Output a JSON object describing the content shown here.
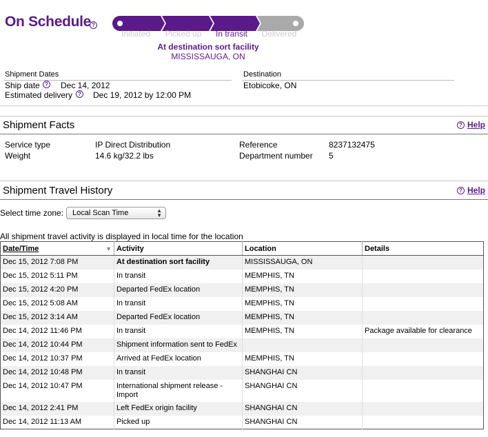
{
  "header": {
    "status_title": "On Schedule",
    "progress_steps": [
      "Initiated",
      "Picked up",
      "In transit",
      "Delivered"
    ],
    "current_step": "In transit",
    "status_line1": "At destination sort facility",
    "status_line2": "MISSISSAUGA, ON"
  },
  "dates": {
    "heading": "Shipment Dates",
    "ship_date_label": "Ship date",
    "ship_date_value": "Dec 14, 2012",
    "est_delivery_label": "Estimated delivery",
    "est_delivery_value": "Dec 19, 2012 by 12:00 PM",
    "destination_heading": "Destination",
    "destination_value": "Etobicoke, ON"
  },
  "facts": {
    "title": "Shipment Facts",
    "help": "Help",
    "service_type_label": "Service type",
    "service_type_value": "IP Direct Distribution",
    "weight_label": "Weight",
    "weight_value": "14.6 kg/32.2 lbs",
    "reference_label": "Reference",
    "reference_value": "8237132475",
    "department_label": "Department number",
    "department_value": "5"
  },
  "history": {
    "title": "Shipment Travel History",
    "help": "Help",
    "tz_label": "Select time zone:",
    "tz_value": "Local Scan Time",
    "note": "All shipment travel activity is displayed in local time for the location",
    "columns": [
      "Date/Time",
      "Activity",
      "Location",
      "Details"
    ],
    "rows": [
      {
        "datetime": "Dec 15, 2012 7:08 PM",
        "activity": "At destination sort facility",
        "location": "MISSISSAUGA, ON",
        "details": ""
      },
      {
        "datetime": "Dec 15, 2012 5:11 PM",
        "activity": "In transit",
        "location": "MEMPHIS, TN",
        "details": ""
      },
      {
        "datetime": "Dec 15, 2012 4:20 PM",
        "activity": "Departed FedEx location",
        "location": "MEMPHIS, TN",
        "details": ""
      },
      {
        "datetime": "Dec 15, 2012 5:08 AM",
        "activity": "In transit",
        "location": "MEMPHIS, TN",
        "details": ""
      },
      {
        "datetime": "Dec 15, 2012 3:14 AM",
        "activity": "Departed FedEx location",
        "location": "MEMPHIS, TN",
        "details": ""
      },
      {
        "datetime": "Dec 14, 2012 11:46 PM",
        "activity": "In transit",
        "location": "MEMPHIS, TN",
        "details": "Package available for clearance"
      },
      {
        "datetime": "Dec 14, 2012 10:44 PM",
        "activity": "Shipment information sent to FedEx",
        "location": "",
        "details": ""
      },
      {
        "datetime": "Dec 14, 2012 10:37 PM",
        "activity": "Arrived at FedEx location",
        "location": "MEMPHIS, TN",
        "details": ""
      },
      {
        "datetime": "Dec 14, 2012 10:48 PM",
        "activity": "In transit",
        "location": "SHANGHAI CN",
        "details": ""
      },
      {
        "datetime": "Dec 14, 2012 10:47 PM",
        "activity": "International shipment release - Import",
        "location": "SHANGHAI CN",
        "details": ""
      },
      {
        "datetime": "Dec 14, 2012 2:41 PM",
        "activity": "Left FedEx origin facility",
        "location": "SHANGHAI CN",
        "details": ""
      },
      {
        "datetime": "Dec 14, 2012 11:13 AM",
        "activity": "Picked up",
        "location": "SHANGHAI CN",
        "details": ""
      }
    ]
  },
  "colors": {
    "brand_purple": "#5a1a8a",
    "progress_gray": "#a9a9a9",
    "row_alt": "#f0f0f0"
  },
  "icons": {
    "help": "question-circle-icon",
    "sort": "sort-down-icon",
    "select_arrows": "up-down-arrows-icon"
  }
}
